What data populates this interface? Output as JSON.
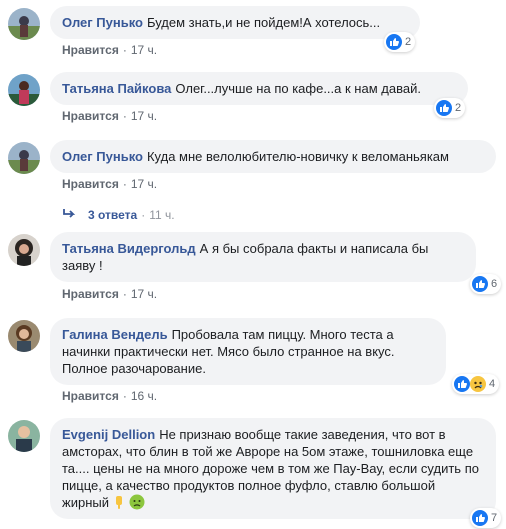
{
  "comments": [
    {
      "author": "Олег Пунько",
      "text": "Будем знать,и не пойдем!А хотелось...",
      "like": "Нравится",
      "time": "17 ч.",
      "reactions": "2"
    },
    {
      "author": "Татьяна Пайкова",
      "text": "Олег...лучше на по кафе...а к нам давай.",
      "like": "Нравится",
      "time": "17 ч.",
      "reactions": "2"
    },
    {
      "author": "Олег Пунько",
      "text": "Куда мне велолюбителю-новичку к веломаньякам",
      "like": "Нравится",
      "time": "17 ч."
    },
    {
      "author": "Татьяна Видергольд",
      "text": "А я бы собрала факты и написала бы заяву !",
      "like": "Нравится",
      "time": "17 ч.",
      "reactions": "6"
    },
    {
      "author": "Галина Вендель",
      "text": "Пробовала там пиццу. Много теста а начинки практически нет. Мясо было странное на вкус. Полное разочарование.",
      "like": "Нравится",
      "time": "16 ч.",
      "reactions": "4"
    },
    {
      "author": "Evgenij Dellion",
      "text": "Не признаю вообще такие заведения, что вот в амсторах, что блин в той же Авроре на 5ом этаже, тошниловка еще та.... цены не на много дороже чем в том же Пау-Вау, если судить по пицце, а качество продуктов полное фуфло, ставлю большой жирный",
      "reactions": "7"
    }
  ],
  "replies_link": {
    "label": "3 ответа",
    "sep": "·",
    "time": "11 ч."
  },
  "colors": {
    "link": "#385898",
    "bubble": "#f2f3f5",
    "like_blue": "#1877f2"
  }
}
